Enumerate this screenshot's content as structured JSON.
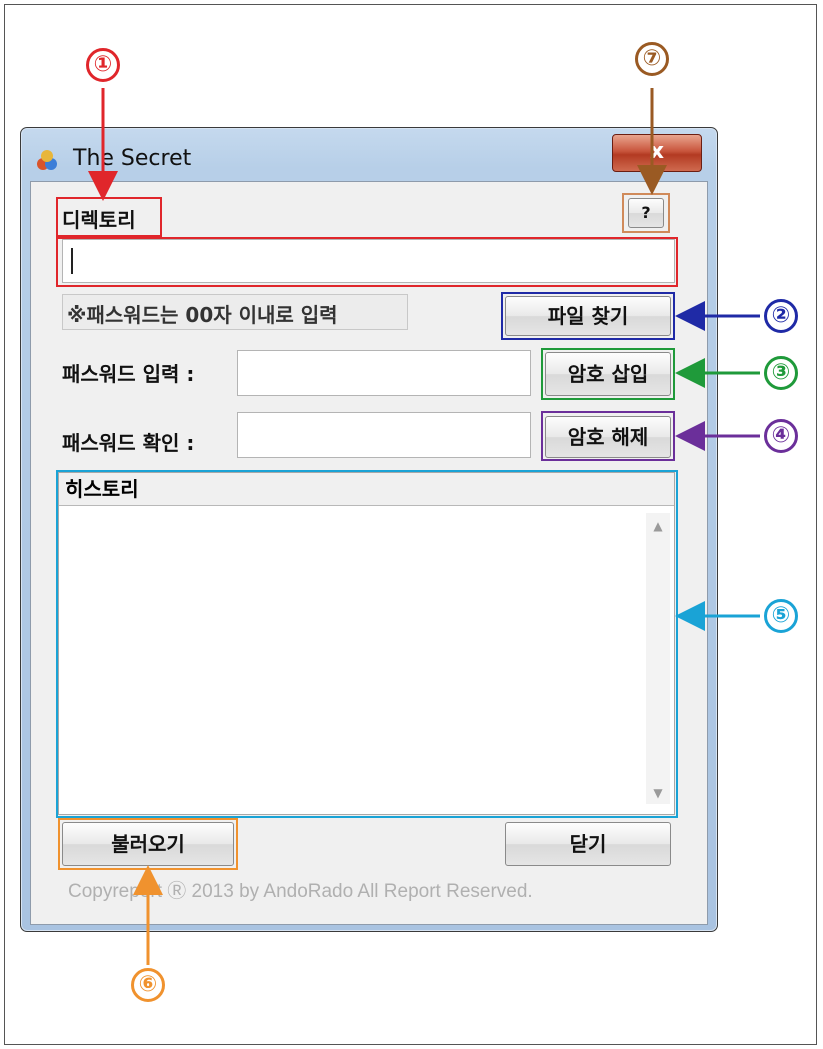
{
  "window": {
    "title": "The Secret",
    "close_label": "x"
  },
  "directory": {
    "label": "디렉토리",
    "value": "",
    "help_label": "?"
  },
  "password_note": "※패스워드는 00자 이내로 입력",
  "buttons": {
    "find_file": "파일 찾기",
    "insert_password": "암호 삽입",
    "remove_password": "암호 해제",
    "load": "불러오기",
    "close": "닫기"
  },
  "password_input": {
    "label": "패스워드 입력 :",
    "value": ""
  },
  "password_confirm": {
    "label": "패스워드 확인 :",
    "value": ""
  },
  "history": {
    "label": "히스토리"
  },
  "copyright": "Copyreport Ⓡ 2013 by AndoRado All Report Reserved.",
  "callouts": [
    "①",
    "②",
    "③",
    "④",
    "⑤",
    "⑥",
    "⑦"
  ],
  "colors": {
    "c1": "#e0262b",
    "c2": "#1f2aa6",
    "c3": "#1f9a3a",
    "c4": "#6b2f9a",
    "c5": "#1aa3d6",
    "c6": "#f0922e",
    "c7": "#9a5a23"
  }
}
